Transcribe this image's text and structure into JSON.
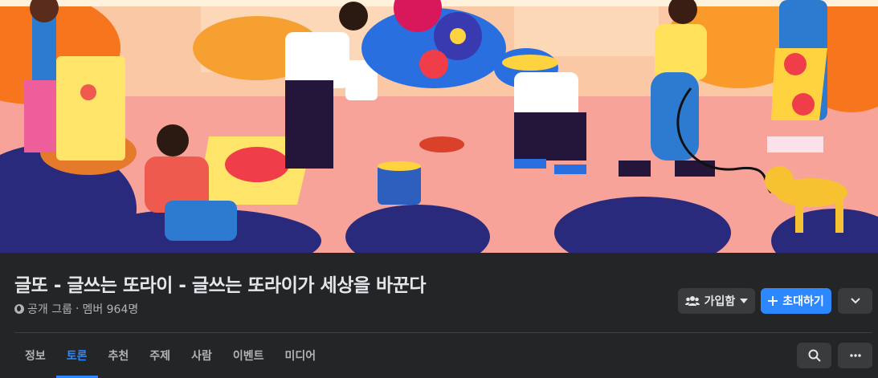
{
  "group": {
    "title": "글또 - 글쓰는 또라이 - 글쓰는 또라이가 세상을 바꾼다",
    "privacy": "공개 그룹",
    "separator": "·",
    "members": "멤버 964명"
  },
  "actions": {
    "join_label": "가입함",
    "invite_label": "초대하기"
  },
  "tabs": [
    {
      "label": "정보"
    },
    {
      "label": "토론"
    },
    {
      "label": "추천"
    },
    {
      "label": "주제"
    },
    {
      "label": "사람"
    },
    {
      "label": "이벤트"
    },
    {
      "label": "미디어"
    }
  ],
  "active_tab": "토론",
  "icons": {
    "join": "people-icon",
    "join_caret": "caret-down-icon",
    "invite": "plus-icon",
    "expand": "chevron-down-icon",
    "search": "search-icon",
    "more": "more-horizontal-icon",
    "privacy": "globe-icon"
  },
  "colors": {
    "accent": "#2d88ff",
    "background": "#242526",
    "text_primary": "#e4e6eb",
    "text_secondary": "#b0b3b8"
  }
}
